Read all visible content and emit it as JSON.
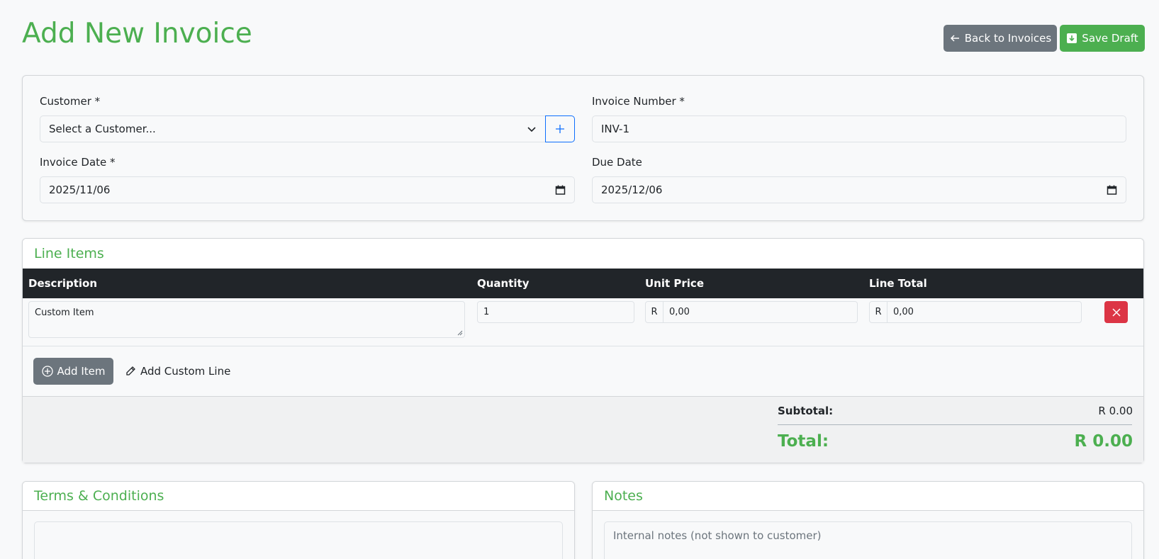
{
  "page": {
    "title": "Add New Invoice"
  },
  "header_buttons": {
    "back": "Back to Invoices",
    "save": "Save Draft"
  },
  "form": {
    "customer_label": "Customer *",
    "customer_value": "Select a Customer...",
    "invoice_number_label": "Invoice Number *",
    "invoice_number_value": "INV-1",
    "invoice_date_label": "Invoice Date *",
    "invoice_date_value": "2025/11/06",
    "due_date_label": "Due Date",
    "due_date_value": "2025/12/06"
  },
  "line_items": {
    "title": "Line Items",
    "columns": [
      "Description",
      "Quantity",
      "Unit Price",
      "Line Total"
    ],
    "rows": [
      {
        "description": "Custom Item",
        "quantity": "1",
        "currency": "R",
        "unit_price": "0,00",
        "line_total": "0,00"
      }
    ],
    "add_item": "Add Item",
    "add_custom_line": "Add Custom Line"
  },
  "totals": {
    "subtotal_label": "Subtotal:",
    "subtotal_value": "R 0.00",
    "total_label": "Total:",
    "total_value": "R 0.00"
  },
  "terms": {
    "title": "Terms & Conditions",
    "placeholder": ""
  },
  "notes": {
    "title": "Notes",
    "placeholder": "Internal notes (not shown to customer)"
  },
  "colors": {
    "accent": "#4caf50",
    "secondary": "#6c757d",
    "danger": "#dc3545",
    "dark": "#212529",
    "primary": "#0d6efd"
  }
}
